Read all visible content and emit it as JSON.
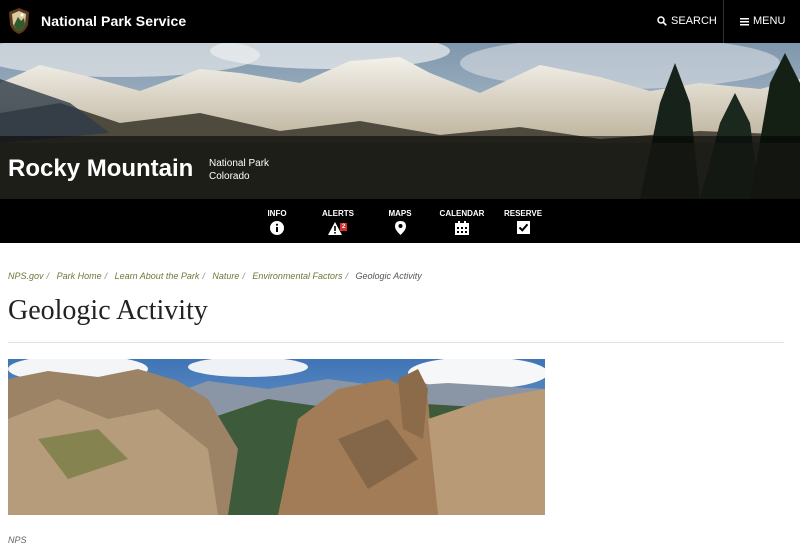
{
  "header": {
    "site_name": "National Park Service",
    "search_label": "SEARCH",
    "menu_label": "MENU"
  },
  "park": {
    "name": "Rocky Mountain",
    "type": "National Park",
    "state": "Colorado"
  },
  "nav": {
    "info": "INFO",
    "alerts": "ALERTS",
    "alerts_count": "2",
    "maps": "MAPS",
    "calendar": "CALENDAR",
    "reserve": "RESERVE"
  },
  "breadcrumb": [
    "NPS.gov",
    "Park Home",
    "Learn About the Park",
    "Nature",
    "Environmental Factors",
    "Geologic Activity"
  ],
  "page": {
    "title": "Geologic Activity",
    "image_credit": "NPS"
  },
  "colors": {
    "header_bg": "#000000",
    "breadcrumb_link": "#6b7a3a",
    "alert_badge": "#d32f2f"
  }
}
